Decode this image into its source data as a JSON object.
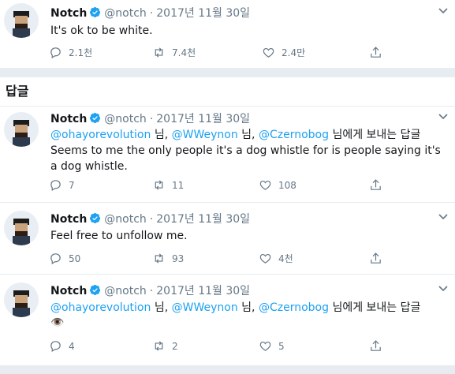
{
  "author": {
    "name": "Notch",
    "handle": "@notch",
    "date": "2017년 11월 30일"
  },
  "main_tweet": {
    "text": "It's ok to be white.",
    "replies": "2.1천",
    "retweets": "7.4천",
    "likes": "2.4만"
  },
  "replies_header": "답글",
  "replies": [
    {
      "mentions": [
        "@ohayorevolution",
        "@WWeynon",
        "@Czernobog"
      ],
      "sep": "님,",
      "to_suffix": "님에게 보내는 답글",
      "text": "Seems to me the only people it's a dog whistle for is people saying it's a dog whistle.",
      "replies": "7",
      "retweets": "11",
      "likes": "108"
    },
    {
      "text": "Feel free to unfollow me.",
      "replies": "50",
      "retweets": "93",
      "likes": "4천"
    },
    {
      "mentions": [
        "@ohayorevolution",
        "@WWeynon",
        "@Czernobog"
      ],
      "sep": "님,",
      "to_suffix": "님에게 보내는 답글",
      "text": "👁️",
      "replies": "4",
      "retweets": "2",
      "likes": "5"
    }
  ],
  "colors": {
    "accent": "#1da1f2",
    "muted": "#657786",
    "divider": "#e6ecf0"
  },
  "icons": [
    "reply-icon",
    "retweet-icon",
    "like-icon",
    "share-icon",
    "verified-badge-icon",
    "caret-down-icon"
  ]
}
